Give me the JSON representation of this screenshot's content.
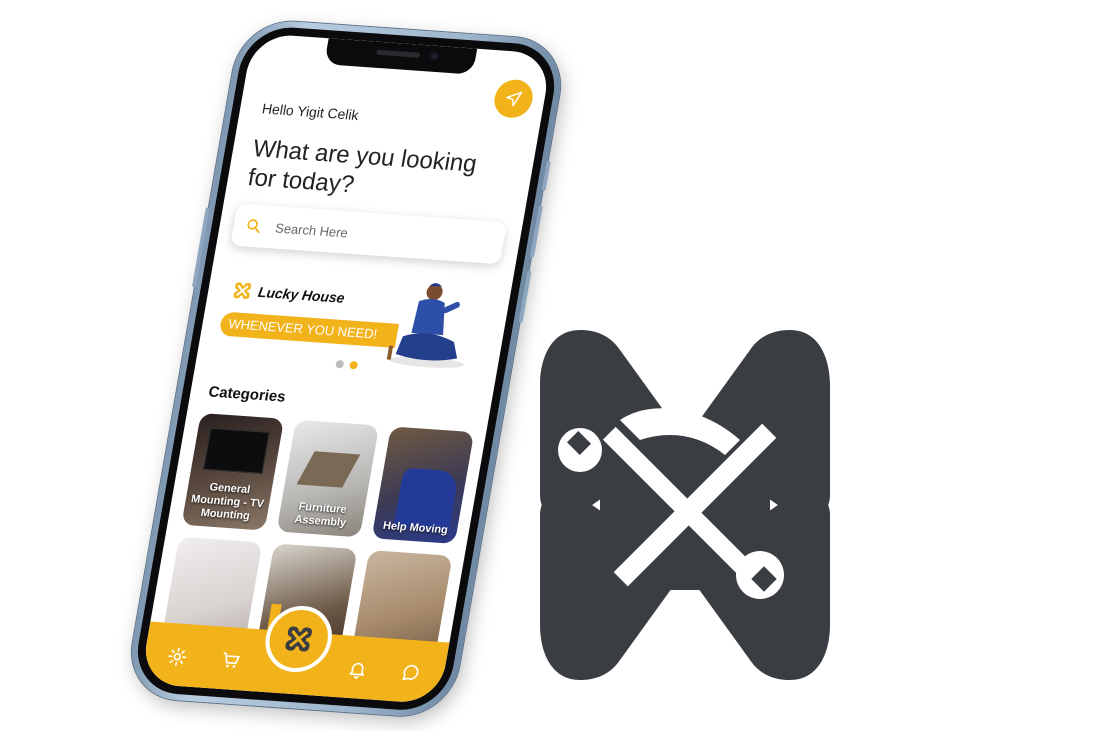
{
  "app": {
    "greeting": "Hello Yigit Celik",
    "question": "What are you looking for today?",
    "send_icon": "send-icon",
    "accent_color": "#f2b21a"
  },
  "search": {
    "placeholder": "Search Here",
    "icon": "search-icon"
  },
  "banner": {
    "brand": "Lucky House",
    "tagline": "WHENEVER YOU NEED!",
    "slides_total": 2,
    "active_slide": 2
  },
  "categories": {
    "title": "Categories",
    "items": [
      {
        "label": "General Mounting - TV Mounting"
      },
      {
        "label": "Furniture Assembly"
      },
      {
        "label": "Help Moving"
      },
      {
        "label": ""
      },
      {
        "label": ""
      },
      {
        "label": ""
      }
    ]
  },
  "navbar": {
    "items": [
      "gear-icon",
      "cart-icon",
      "home-logo-icon",
      "bell-icon",
      "chat-icon"
    ]
  }
}
